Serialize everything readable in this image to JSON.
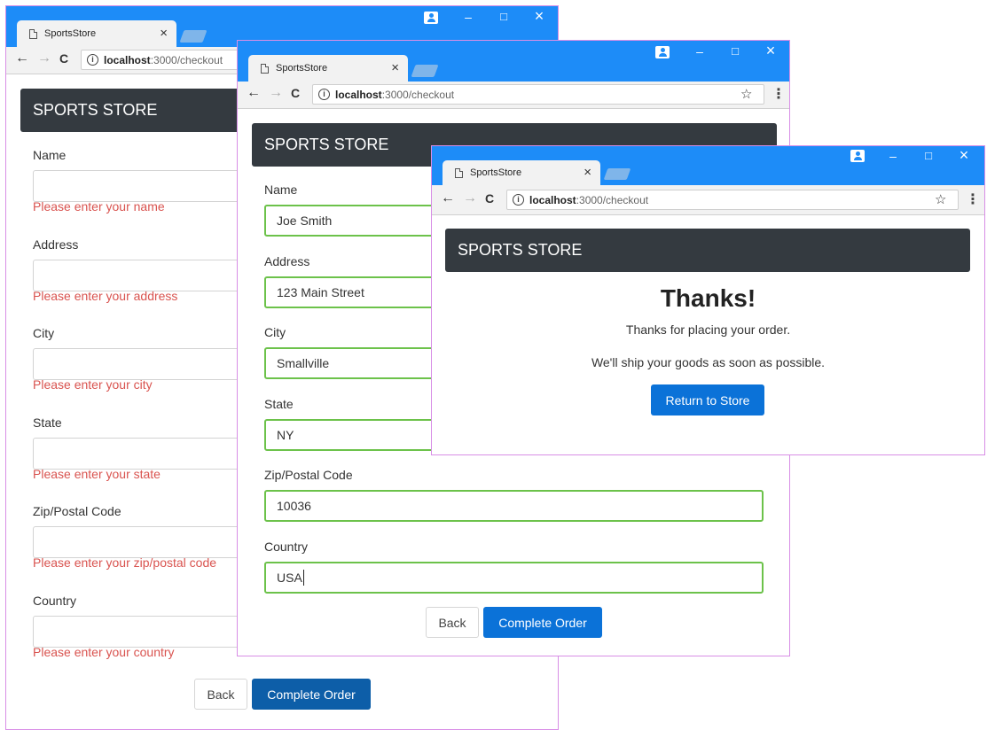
{
  "app": {
    "tab_title": "SportsStore",
    "tab_close": "×",
    "url_host": "localhost",
    "url_path": ":3000/checkout",
    "info_glyph": "i",
    "star_glyph": "☆",
    "menu_glyph": "⋮",
    "back_glyph": "←",
    "forward_glyph": "→",
    "reload_glyph": "C",
    "minimize_glyph": "–",
    "maximize_glyph": "□",
    "close_glyph": "×"
  },
  "brand": "SPORTS STORE",
  "window1": {
    "fields": [
      {
        "label": "Name",
        "value": "",
        "error": "Please enter your name"
      },
      {
        "label": "Address",
        "value": "",
        "error": "Please enter your address"
      },
      {
        "label": "City",
        "value": "",
        "error": "Please enter your city"
      },
      {
        "label": "State",
        "value": "",
        "error": "Please enter your state"
      },
      {
        "label": "Zip/Postal Code",
        "value": "",
        "error": "Please enter your zip/postal code"
      },
      {
        "label": "Country",
        "value": "",
        "error": "Please enter your country"
      }
    ],
    "back_label": "Back",
    "submit_label": "Complete Order"
  },
  "window2": {
    "fields": [
      {
        "label": "Name",
        "value": "Joe Smith"
      },
      {
        "label": "Address",
        "value": "123 Main Street"
      },
      {
        "label": "City",
        "value": "Smallville"
      },
      {
        "label": "State",
        "value": "NY"
      },
      {
        "label": "Zip/Postal Code",
        "value": "10036"
      },
      {
        "label": "Country",
        "value": "USA"
      }
    ],
    "back_label": "Back",
    "submit_label": "Complete Order"
  },
  "window3": {
    "heading": "Thanks!",
    "line1": "Thanks for placing your order.",
    "line2": "We'll ship your goods as soon as possible.",
    "return_label": "Return to Store"
  },
  "colors": {
    "titlebar": "#1d8cf8",
    "brand_bar": "#343a40",
    "error_text": "#d9534f",
    "valid_border": "#6cc24a",
    "primary_button": "#0b72d8"
  }
}
